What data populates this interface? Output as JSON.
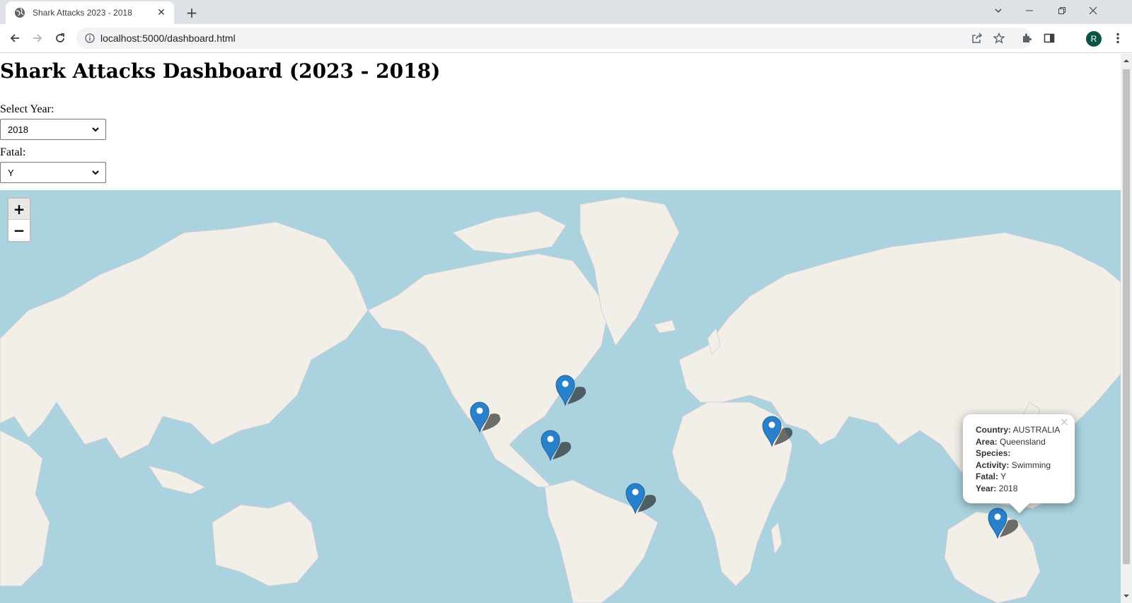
{
  "browser": {
    "tab_title": "Shark Attacks 2023 - 2018",
    "url": "localhost:5000/dashboard.html",
    "profile_initial": "R",
    "accent": "#0b5345"
  },
  "page": {
    "title": "Shark Attacks Dashboard (2023 - 2018)",
    "year_label": "Select Year:",
    "year_value": "2018",
    "fatal_label": "Fatal:",
    "fatal_value": "Y"
  },
  "map": {
    "zoom_in": "+",
    "zoom_out": "−",
    "marker_color": "#2a81cb",
    "water_color": "#aad3df",
    "land_color": "#f2efe9",
    "markers": [
      {
        "name": "marker-west-us"
      },
      {
        "name": "marker-east-us"
      },
      {
        "name": "marker-caribbean"
      },
      {
        "name": "marker-brazil"
      },
      {
        "name": "marker-egypt"
      },
      {
        "name": "marker-australia"
      }
    ]
  },
  "popup": {
    "country_label": "Country:",
    "country": "AUSTRALIA",
    "area_label": "Area:",
    "area": "Queensland",
    "species_label": "Species:",
    "species": "",
    "activity_label": "Activity:",
    "activity": "Swimming",
    "fatal_label": "Fatal:",
    "fatal": "Y",
    "year_label": "Year:",
    "year": "2018",
    "close": "×"
  }
}
